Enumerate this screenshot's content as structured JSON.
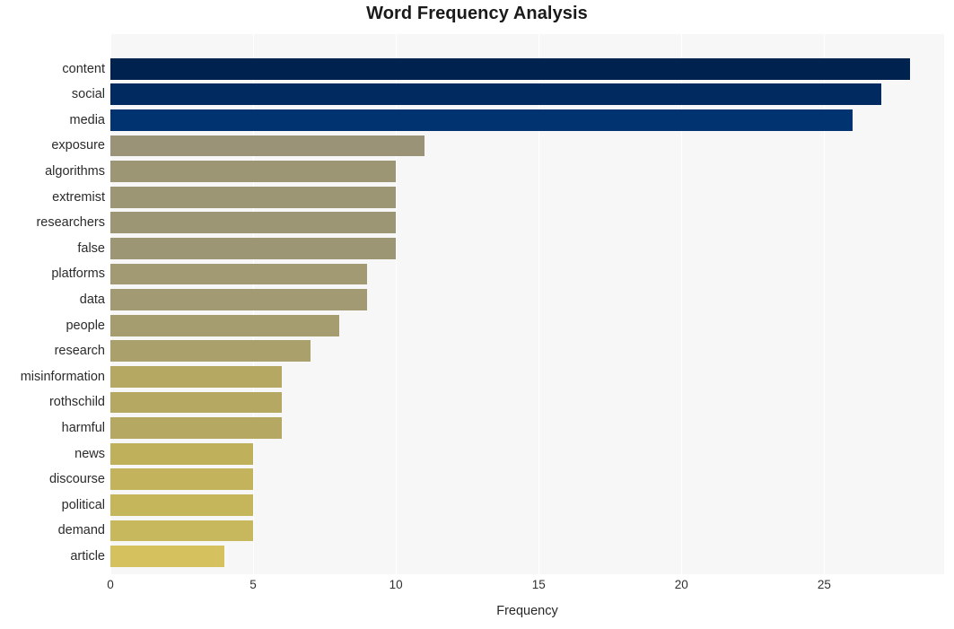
{
  "chart_data": {
    "type": "bar",
    "orientation": "horizontal",
    "title": "Word Frequency Analysis",
    "xlabel": "Frequency",
    "ylabel": "",
    "categories": [
      "content",
      "social",
      "media",
      "exposure",
      "algorithms",
      "extremist",
      "researchers",
      "false",
      "platforms",
      "data",
      "people",
      "research",
      "misinformation",
      "rothschild",
      "harmful",
      "news",
      "discourse",
      "political",
      "demand",
      "article"
    ],
    "values": [
      28,
      27,
      26,
      11,
      10,
      10,
      10,
      10,
      9,
      9,
      8,
      7,
      6,
      6,
      6,
      5,
      5,
      5,
      5,
      4
    ],
    "bar_colors": [
      "#00224e",
      "#002a60",
      "#00336f",
      "#9a9378",
      "#9d9675",
      "#9d9675",
      "#9d9675",
      "#9d9675",
      "#a19a72",
      "#a19a72",
      "#a59d6f",
      "#a9a06c",
      "#b5a862",
      "#b5a862",
      "#b5a862",
      "#bfb05c",
      "#c2b35c",
      "#c5b65c",
      "#c8b85d",
      "#d5c25e"
    ],
    "xlim": [
      0,
      29.2
    ],
    "xticks": [
      0,
      5,
      10,
      15,
      20,
      25
    ],
    "xtick_labels": [
      "0",
      "5",
      "10",
      "15",
      "20",
      "25"
    ],
    "grid": true,
    "legend": false,
    "plot_background": "#f7f7f7",
    "figure_background": "#ffffff"
  }
}
